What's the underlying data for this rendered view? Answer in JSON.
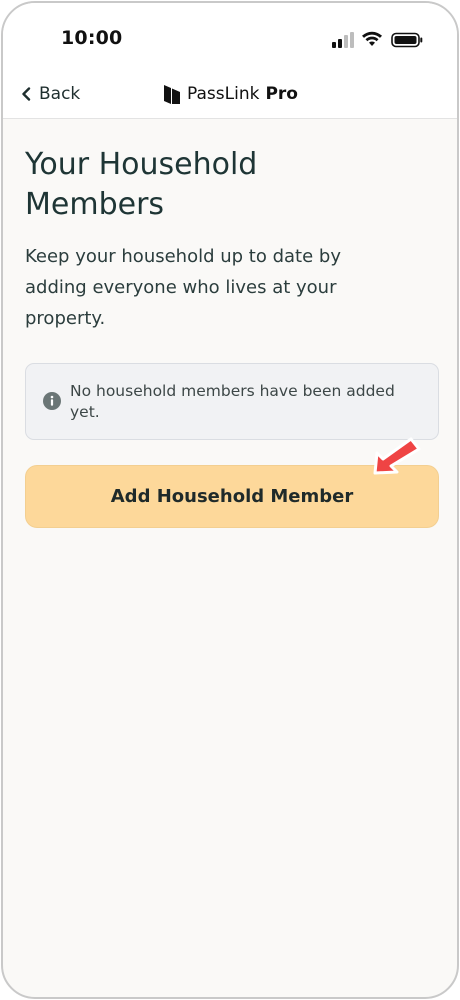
{
  "status_bar": {
    "time": "10:00",
    "icons": [
      "signal-icon",
      "wifi-icon",
      "battery-icon"
    ]
  },
  "nav": {
    "back_label": "Back",
    "brand_name": "PassLink",
    "brand_suffix": "Pro"
  },
  "page": {
    "title_line1": "Your Household",
    "title_line2": "Members",
    "subtitle_line1": "Keep your household up to date by",
    "subtitle_line2": "adding everyone who lives at your",
    "subtitle_line3": "property."
  },
  "info": {
    "message_line1": "No household members have been added",
    "message_line2": "yet."
  },
  "actions": {
    "add_member_label": "Add Household Member"
  },
  "colors": {
    "background": "#faf9f7",
    "button": "#fdd89a",
    "info_box": "#f1f2f4",
    "arrow": "#ef4444",
    "title": "#1e3535"
  }
}
